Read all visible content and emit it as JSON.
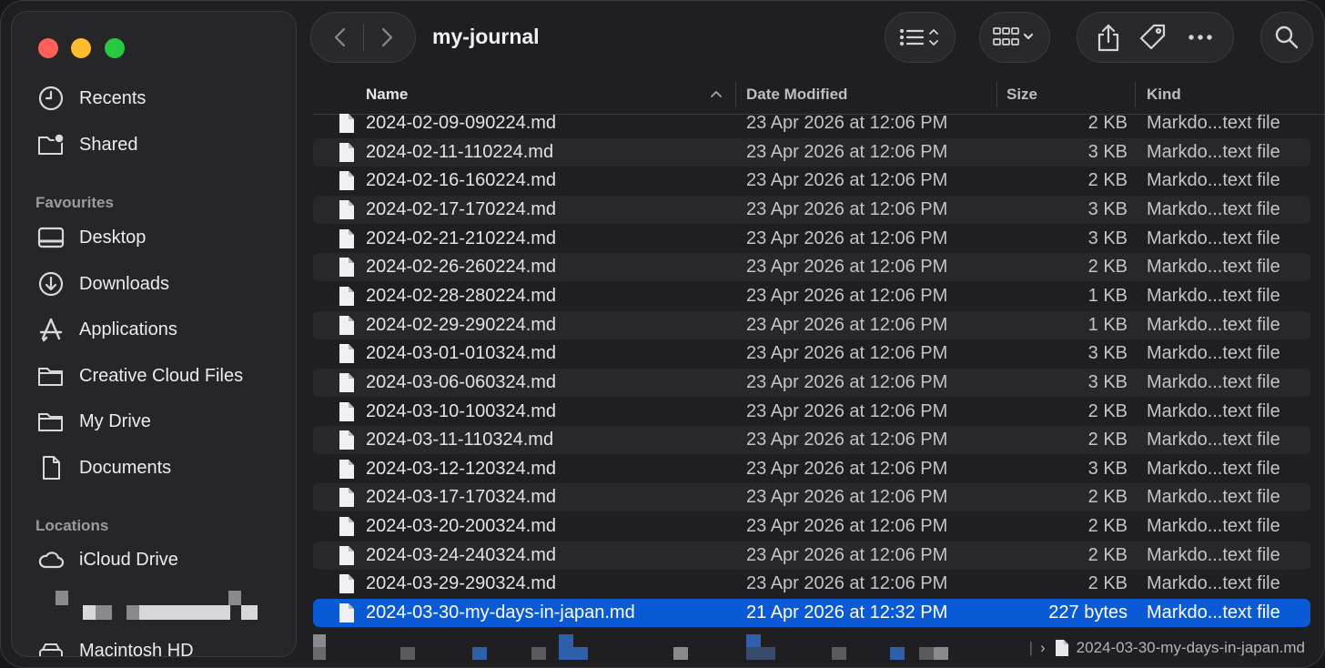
{
  "window": {
    "title": "my-journal"
  },
  "sidebar": {
    "top_items": [
      {
        "label": "Recents",
        "icon": "clock-icon"
      },
      {
        "label": "Shared",
        "icon": "shared-folder-icon"
      }
    ],
    "favourites_header": "Favourites",
    "favourites": [
      {
        "label": "Desktop",
        "icon": "desktop-icon"
      },
      {
        "label": "Downloads",
        "icon": "download-icon"
      },
      {
        "label": "Applications",
        "icon": "applications-icon"
      },
      {
        "label": "Creative Cloud Files",
        "icon": "folder-icon"
      },
      {
        "label": "My Drive",
        "icon": "folder-icon"
      },
      {
        "label": "Documents",
        "icon": "document-icon"
      }
    ],
    "locations_header": "Locations",
    "locations": [
      {
        "label": "iCloud Drive",
        "icon": "cloud-icon"
      },
      {
        "label": "Macintosh HD",
        "icon": "disk-icon"
      }
    ]
  },
  "columns": {
    "name": "Name",
    "date": "Date Modified",
    "size": "Size",
    "kind": "Kind"
  },
  "files": [
    {
      "name": "2024-02-09-090224.md",
      "date": "23 Apr 2026 at 12:06 PM",
      "size": "2 KB",
      "kind": "Markdo...text file"
    },
    {
      "name": "2024-02-11-110224.md",
      "date": "23 Apr 2026 at 12:06 PM",
      "size": "3 KB",
      "kind": "Markdo...text file"
    },
    {
      "name": "2024-02-16-160224.md",
      "date": "23 Apr 2026 at 12:06 PM",
      "size": "2 KB",
      "kind": "Markdo...text file"
    },
    {
      "name": "2024-02-17-170224.md",
      "date": "23 Apr 2026 at 12:06 PM",
      "size": "3 KB",
      "kind": "Markdo...text file"
    },
    {
      "name": "2024-02-21-210224.md",
      "date": "23 Apr 2026 at 12:06 PM",
      "size": "3 KB",
      "kind": "Markdo...text file"
    },
    {
      "name": "2024-02-26-260224.md",
      "date": "23 Apr 2026 at 12:06 PM",
      "size": "2 KB",
      "kind": "Markdo...text file"
    },
    {
      "name": "2024-02-28-280224.md",
      "date": "23 Apr 2026 at 12:06 PM",
      "size": "1 KB",
      "kind": "Markdo...text file"
    },
    {
      "name": "2024-02-29-290224.md",
      "date": "23 Apr 2026 at 12:06 PM",
      "size": "1 KB",
      "kind": "Markdo...text file"
    },
    {
      "name": "2024-03-01-010324.md",
      "date": "23 Apr 2026 at 12:06 PM",
      "size": "3 KB",
      "kind": "Markdo...text file"
    },
    {
      "name": "2024-03-06-060324.md",
      "date": "23 Apr 2026 at 12:06 PM",
      "size": "3 KB",
      "kind": "Markdo...text file"
    },
    {
      "name": "2024-03-10-100324.md",
      "date": "23 Apr 2026 at 12:06 PM",
      "size": "2 KB",
      "kind": "Markdo...text file"
    },
    {
      "name": "2024-03-11-110324.md",
      "date": "23 Apr 2026 at 12:06 PM",
      "size": "2 KB",
      "kind": "Markdo...text file"
    },
    {
      "name": "2024-03-12-120324.md",
      "date": "23 Apr 2026 at 12:06 PM",
      "size": "3 KB",
      "kind": "Markdo...text file"
    },
    {
      "name": "2024-03-17-170324.md",
      "date": "23 Apr 2026 at 12:06 PM",
      "size": "2 KB",
      "kind": "Markdo...text file"
    },
    {
      "name": "2024-03-20-200324.md",
      "date": "23 Apr 2026 at 12:06 PM",
      "size": "2 KB",
      "kind": "Markdo...text file"
    },
    {
      "name": "2024-03-24-240324.md",
      "date": "23 Apr 2026 at 12:06 PM",
      "size": "2 KB",
      "kind": "Markdo...text file"
    },
    {
      "name": "2024-03-29-290324.md",
      "date": "23 Apr 2026 at 12:06 PM",
      "size": "2 KB",
      "kind": "Markdo...text file"
    },
    {
      "name": "2024-03-30-my-days-in-japan.md",
      "date": "21 Apr 2026 at 12:32 PM",
      "size": "227 bytes",
      "kind": "Markdo...text file",
      "selected": true
    }
  ],
  "pathbar": {
    "separator": "›",
    "current_file": "2024-03-30-my-days-in-japan.md"
  },
  "colors": {
    "selection": "#0a5ad6",
    "close": "#fe5f57",
    "minimize": "#febc2e",
    "zoom": "#28c840"
  }
}
